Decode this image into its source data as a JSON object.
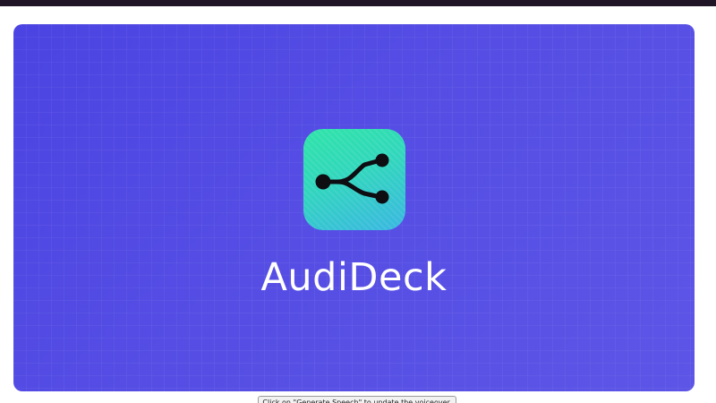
{
  "brand": {
    "name": "AudiDeck",
    "logo_icon": "branch-split-icon"
  },
  "footer": {
    "hint_text": "Click on \"Generate Speech\" to update the voiceover."
  },
  "colors": {
    "stage_background": "#564ee4",
    "logo_gradient_start": "#2fe4a8",
    "logo_gradient_end": "#3ab7e2",
    "icon_color": "#0d0d12",
    "brand_text": "#ffffff"
  }
}
